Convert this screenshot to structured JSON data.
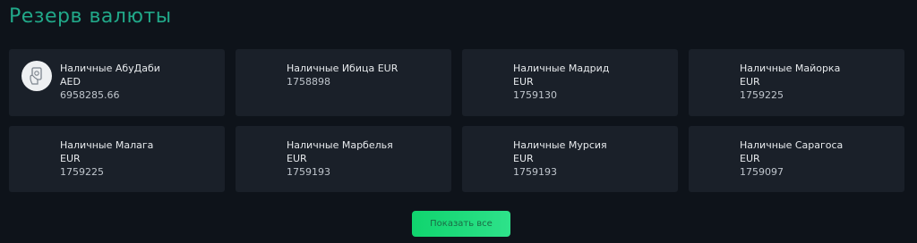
{
  "section": {
    "title": "Резерв валюты"
  },
  "reserves": [
    {
      "name": "Наличные АбуДаби",
      "currency": "AED",
      "amount": "6958285.66",
      "icon": "cash-hand-icon"
    },
    {
      "name": "Наличные Ибица EUR",
      "currency": "",
      "amount": "1758898",
      "icon": ""
    },
    {
      "name": "Наличные Мадрид",
      "currency": "EUR",
      "amount": "1759130",
      "icon": ""
    },
    {
      "name": "Наличные Майорка",
      "currency": "EUR",
      "amount": "1759225",
      "icon": ""
    },
    {
      "name": "Наличные Малага",
      "currency": "EUR",
      "amount": "1759225",
      "icon": ""
    },
    {
      "name": "Наличные Марбелья",
      "currency": "EUR",
      "amount": "1759193",
      "icon": ""
    },
    {
      "name": "Наличные Мурсия",
      "currency": "EUR",
      "amount": "1759193",
      "icon": ""
    },
    {
      "name": "Наличные Сарагоса",
      "currency": "EUR",
      "amount": "1759097",
      "icon": ""
    }
  ],
  "actions": {
    "show_all_label": "Показать все"
  },
  "colors": {
    "background": "#0e131a",
    "card": "#1a2029",
    "title": "#21a889",
    "button": "#10d46e"
  }
}
